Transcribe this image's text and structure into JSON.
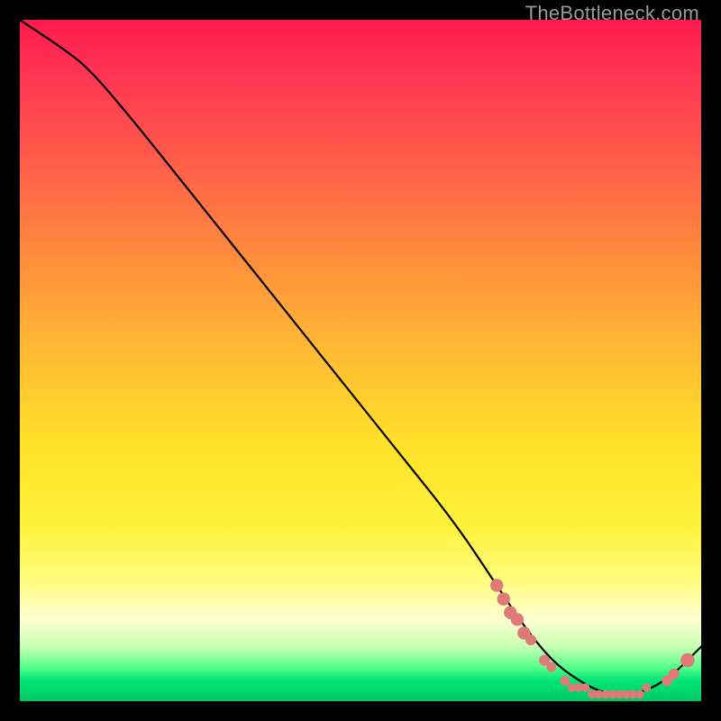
{
  "watermark": "TheBottleneck.com",
  "colors": {
    "background": "#000000",
    "curve": "#000000",
    "dot": "#e07a78",
    "gradient_top": "#ff1a4d",
    "gradient_bottom": "#00c865"
  },
  "chart_data": {
    "type": "line",
    "title": "",
    "xlabel": "",
    "ylabel": "",
    "xlim": [
      0,
      100
    ],
    "ylim": [
      0,
      100
    ],
    "grid": false,
    "legend": false,
    "annotations": [
      "TheBottleneck.com"
    ],
    "series": [
      {
        "name": "curve",
        "x": [
          0,
          3,
          6,
          10,
          16,
          24,
          32,
          40,
          48,
          56,
          64,
          70,
          74,
          78,
          82,
          86,
          90,
          93,
          96,
          100
        ],
        "y": [
          100,
          98,
          96,
          93,
          86,
          76,
          66,
          56,
          46,
          36,
          26,
          17,
          11,
          6,
          3,
          1,
          1,
          2,
          4,
          8
        ]
      }
    ],
    "markers": [
      {
        "x": 70,
        "y": 17,
        "r": 1.2
      },
      {
        "x": 71,
        "y": 15,
        "r": 1.2
      },
      {
        "x": 72,
        "y": 13,
        "r": 1.2
      },
      {
        "x": 73,
        "y": 12,
        "r": 1.2
      },
      {
        "x": 74,
        "y": 10,
        "r": 1.2
      },
      {
        "x": 75,
        "y": 9,
        "r": 1.0
      },
      {
        "x": 77,
        "y": 6,
        "r": 1.0
      },
      {
        "x": 78,
        "y": 5,
        "r": 0.9
      },
      {
        "x": 80,
        "y": 3,
        "r": 0.9
      },
      {
        "x": 81,
        "y": 2,
        "r": 0.8
      },
      {
        "x": 82,
        "y": 2,
        "r": 0.8
      },
      {
        "x": 83,
        "y": 2,
        "r": 0.8
      },
      {
        "x": 84,
        "y": 1,
        "r": 0.8
      },
      {
        "x": 85,
        "y": 1,
        "r": 0.8
      },
      {
        "x": 86,
        "y": 1,
        "r": 0.8
      },
      {
        "x": 87,
        "y": 1,
        "r": 0.8
      },
      {
        "x": 88,
        "y": 1,
        "r": 0.8
      },
      {
        "x": 89,
        "y": 1,
        "r": 0.8
      },
      {
        "x": 90,
        "y": 1,
        "r": 0.8
      },
      {
        "x": 91,
        "y": 1,
        "r": 0.8
      },
      {
        "x": 92,
        "y": 2,
        "r": 0.8
      },
      {
        "x": 95,
        "y": 3,
        "r": 1.0
      },
      {
        "x": 96,
        "y": 4,
        "r": 1.0
      },
      {
        "x": 98,
        "y": 6,
        "r": 1.3
      }
    ]
  }
}
